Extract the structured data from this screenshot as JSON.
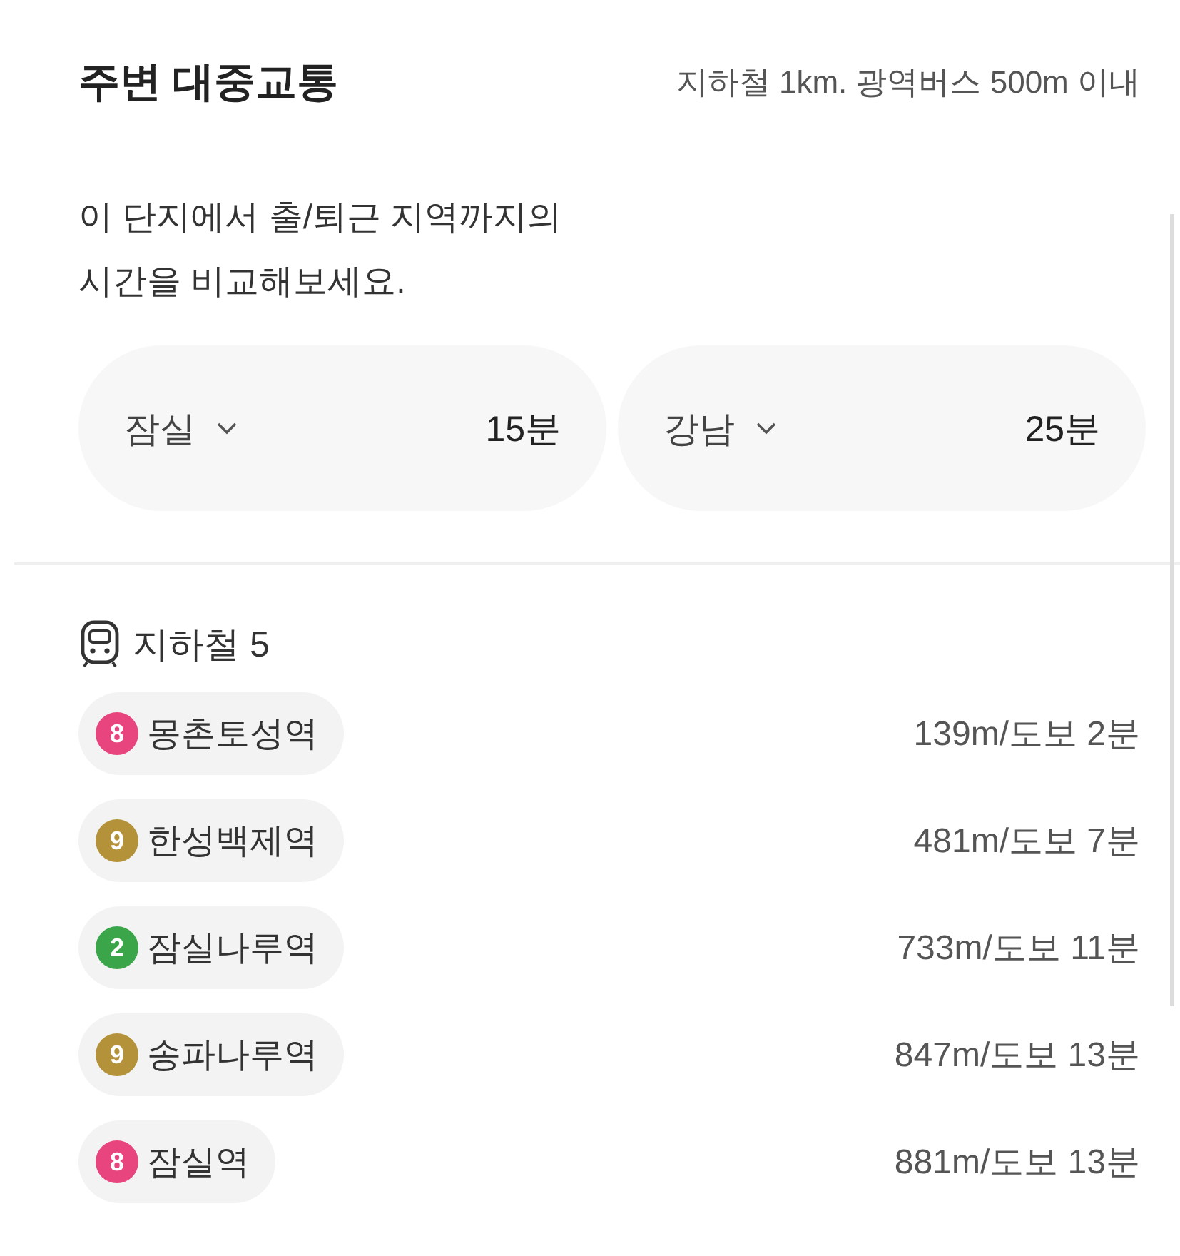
{
  "header": {
    "title": "주변 대중교통",
    "note": "지하철 1km. 광역버스 500m 이내"
  },
  "description": "이 단지에서 출/퇴근 지역까지의\n시간을 비교해보세요.",
  "commutes": [
    {
      "area": "잠실",
      "time": "15분"
    },
    {
      "area": "강남",
      "time": "25분"
    }
  ],
  "subway": {
    "title": "지하철 5",
    "stations": [
      {
        "line": "8",
        "color": "#e8457e",
        "name": "몽촌토성역",
        "distance": "139m/도보 2분"
      },
      {
        "line": "9",
        "color": "#b3923a",
        "name": "한성백제역",
        "distance": "481m/도보 7분"
      },
      {
        "line": "2",
        "color": "#3ba54a",
        "name": "잠실나루역",
        "distance": "733m/도보 11분"
      },
      {
        "line": "9",
        "color": "#b3923a",
        "name": "송파나루역",
        "distance": "847m/도보 13분"
      },
      {
        "line": "8",
        "color": "#e8457e",
        "name": "잠실역",
        "distance": "881m/도보 13분"
      }
    ]
  }
}
